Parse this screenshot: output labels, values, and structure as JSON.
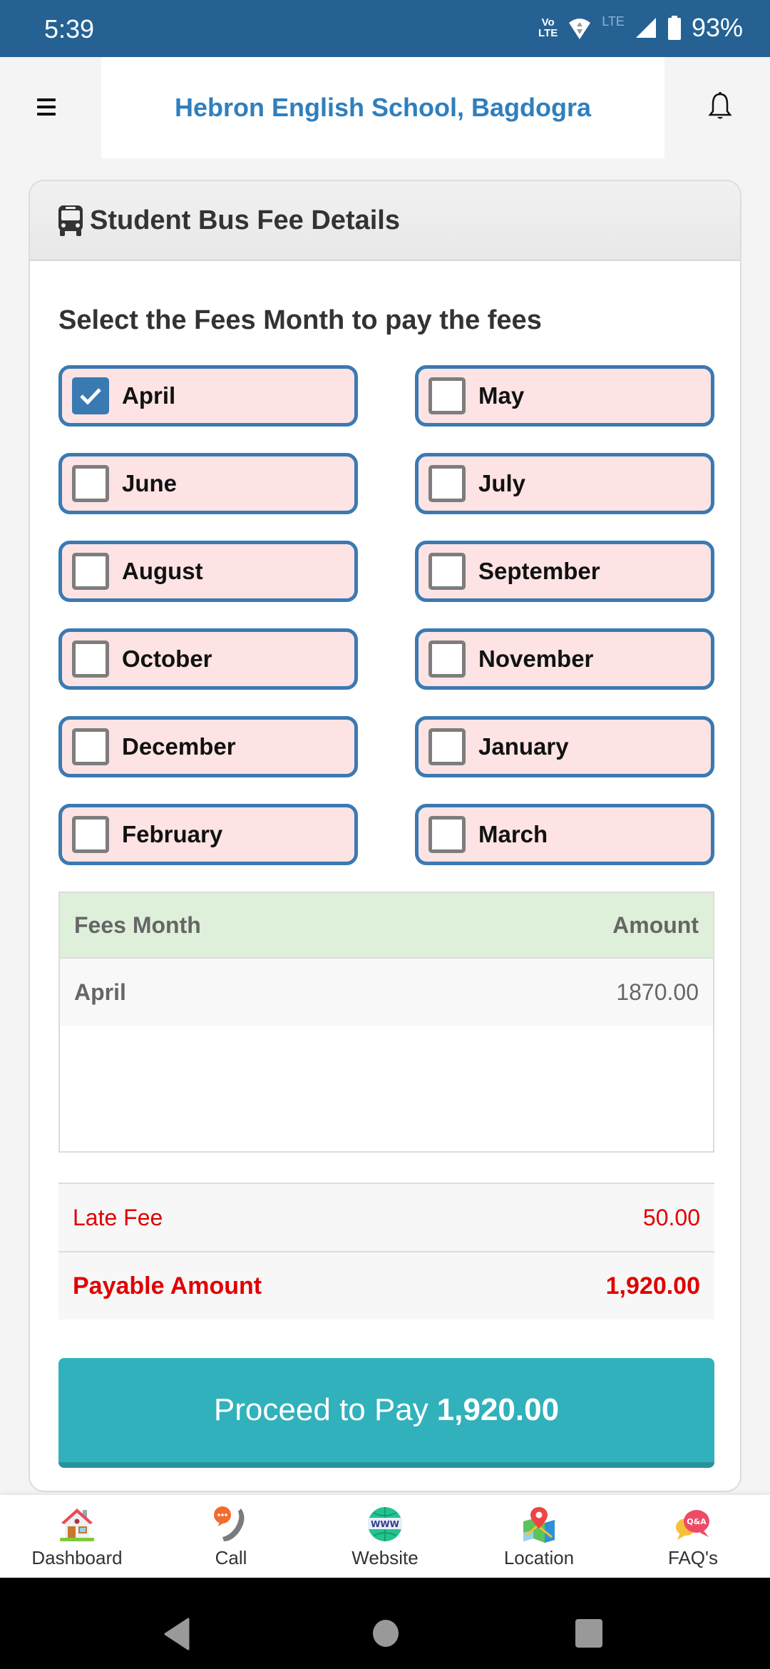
{
  "status_bar": {
    "time": "5:39",
    "volte_top": "Vo",
    "volte_bottom": "LTE",
    "network": "LTE",
    "battery": "93%"
  },
  "header": {
    "title": "Hebron English School, Bagdogra"
  },
  "card": {
    "title": "Student Bus Fee Details",
    "section_title": "Select the Fees Month to pay the fees"
  },
  "months": [
    {
      "label": "April",
      "checked": true
    },
    {
      "label": "May",
      "checked": false
    },
    {
      "label": "June",
      "checked": false
    },
    {
      "label": "July",
      "checked": false
    },
    {
      "label": "August",
      "checked": false
    },
    {
      "label": "September",
      "checked": false
    },
    {
      "label": "October",
      "checked": false
    },
    {
      "label": "November",
      "checked": false
    },
    {
      "label": "December",
      "checked": false
    },
    {
      "label": "January",
      "checked": false
    },
    {
      "label": "February",
      "checked": false
    },
    {
      "label": "March",
      "checked": false
    }
  ],
  "fee_table": {
    "headers": {
      "month": "Fees Month",
      "amount": "Amount"
    },
    "rows": [
      {
        "month": "April",
        "amount": "1870.00"
      }
    ]
  },
  "summary": {
    "late_fee_label": "Late Fee",
    "late_fee_value": "50.00",
    "payable_label": "Payable Amount",
    "payable_value": "1,920.00"
  },
  "pay_button": {
    "prefix": "Proceed to Pay",
    "amount": "1,920.00"
  },
  "bottom_nav": [
    {
      "label": "Dashboard",
      "icon": "house-icon"
    },
    {
      "label": "Call",
      "icon": "phone-icon"
    },
    {
      "label": "Website",
      "icon": "globe-www-icon"
    },
    {
      "label": "Location",
      "icon": "map-pin-icon"
    },
    {
      "label": "FAQ's",
      "icon": "qa-bubble-icon"
    }
  ],
  "colors": {
    "status_bar": "#256293",
    "brand_blue": "#2f7fbd",
    "month_bg": "#fde3e4",
    "month_border": "#3a7ab3",
    "table_head": "#dff0da",
    "alert_red": "#e00000",
    "pay_button": "#31b1bc"
  }
}
